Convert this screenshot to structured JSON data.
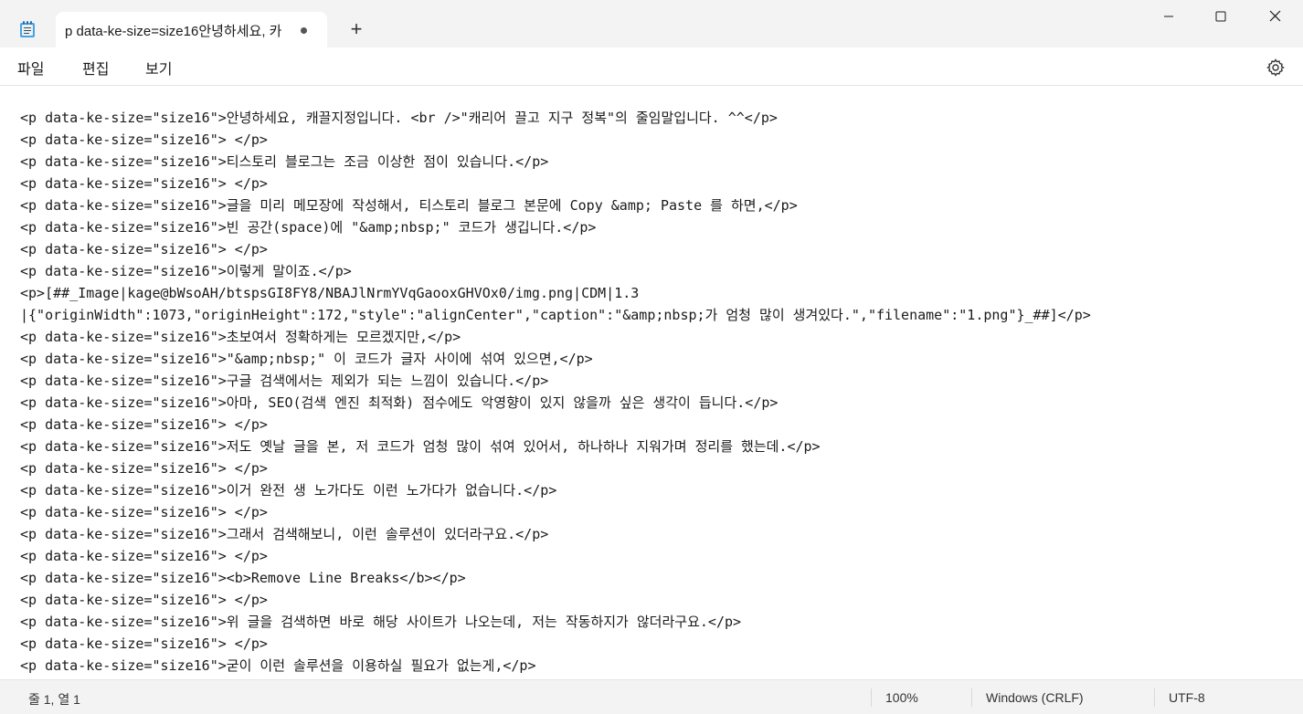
{
  "titlebar": {
    "tab_title": "p data-ke-size=size16안녕하세요, 카",
    "new_tab_label": "+"
  },
  "menu": {
    "file": "파일",
    "edit": "편집",
    "view": "보기"
  },
  "icons": {
    "app": "notepad-icon",
    "unsaved": "unsaved-dot-icon",
    "minimize": "minimize-icon",
    "maximize": "maximize-icon",
    "close": "close-icon",
    "settings": "gear-icon"
  },
  "editor": {
    "lines": [
      "<p data-ke-size=\"size16\">안녕하세요, 캐끌지정입니다. <br />\"캐리어 끌고 지구 정복\"의 줄임말입니다. ^^</p>",
      "<p data-ke-size=\"size16\"> </p>",
      "<p data-ke-size=\"size16\">티스토리 블로그는 조금 이상한 점이 있습니다.</p>",
      "<p data-ke-size=\"size16\"> </p>",
      "<p data-ke-size=\"size16\">글을 미리 메모장에 작성해서, 티스토리 블로그 본문에 Copy &amp; Paste 를 하면,</p>",
      "<p data-ke-size=\"size16\">빈 공간(space)에 \"&amp;nbsp;\" 코드가 생깁니다.</p>",
      "<p data-ke-size=\"size16\"> </p>",
      "<p data-ke-size=\"size16\">이렇게 말이죠.</p>",
      "<p>[##_Image|kage@bWsoAH/btspsGI8FY8/NBAJlNrmYVqGaooxGHVOx0/img.png|CDM|1.3",
      "|{\"originWidth\":1073,\"originHeight\":172,\"style\":\"alignCenter\",\"caption\":\"&amp;nbsp;가 엄청 많이 생겨있다.\",\"filename\":\"1.png\"}_##]</p>",
      "<p data-ke-size=\"size16\">초보여서 정확하게는 모르겠지만,</p>",
      "<p data-ke-size=\"size16\">\"&amp;nbsp;\" 이 코드가 글자 사이에 섞여 있으면,</p>",
      "<p data-ke-size=\"size16\">구글 검색에서는 제외가 되는 느낌이 있습니다.</p>",
      "<p data-ke-size=\"size16\">아마, SEO(검색 엔진 최적화) 점수에도 악영향이 있지 않을까 싶은 생각이 듭니다.</p>",
      "<p data-ke-size=\"size16\"> </p>",
      "<p data-ke-size=\"size16\">저도 옛날 글을 본, 저 코드가 엄청 많이 섞여 있어서, 하나하나 지워가며 정리를 했는데.</p>",
      "<p data-ke-size=\"size16\"> </p>",
      "<p data-ke-size=\"size16\">이거 완전 생 노가다도 이런 노가다가 없습니다.</p>",
      "<p data-ke-size=\"size16\"> </p>",
      "<p data-ke-size=\"size16\">그래서 검색해보니, 이런 솔루션이 있더라구요.</p>",
      "<p data-ke-size=\"size16\"> </p>",
      "<p data-ke-size=\"size16\"><b>Remove Line Breaks</b></p>",
      "<p data-ke-size=\"size16\"> </p>",
      "<p data-ke-size=\"size16\">위 글을 검색하면 바로 해당 사이트가 나오는데, 저는 작동하지가 않더라구요.</p>",
      "<p data-ke-size=\"size16\"> </p>",
      "<p data-ke-size=\"size16\">굳이 이런 솔루션을 이용하실 필요가 없는게,</p>"
    ]
  },
  "status": {
    "position": "줄 1, 열 1",
    "zoom": "100%",
    "line_ending": "Windows (CRLF)",
    "encoding": "UTF-8"
  }
}
